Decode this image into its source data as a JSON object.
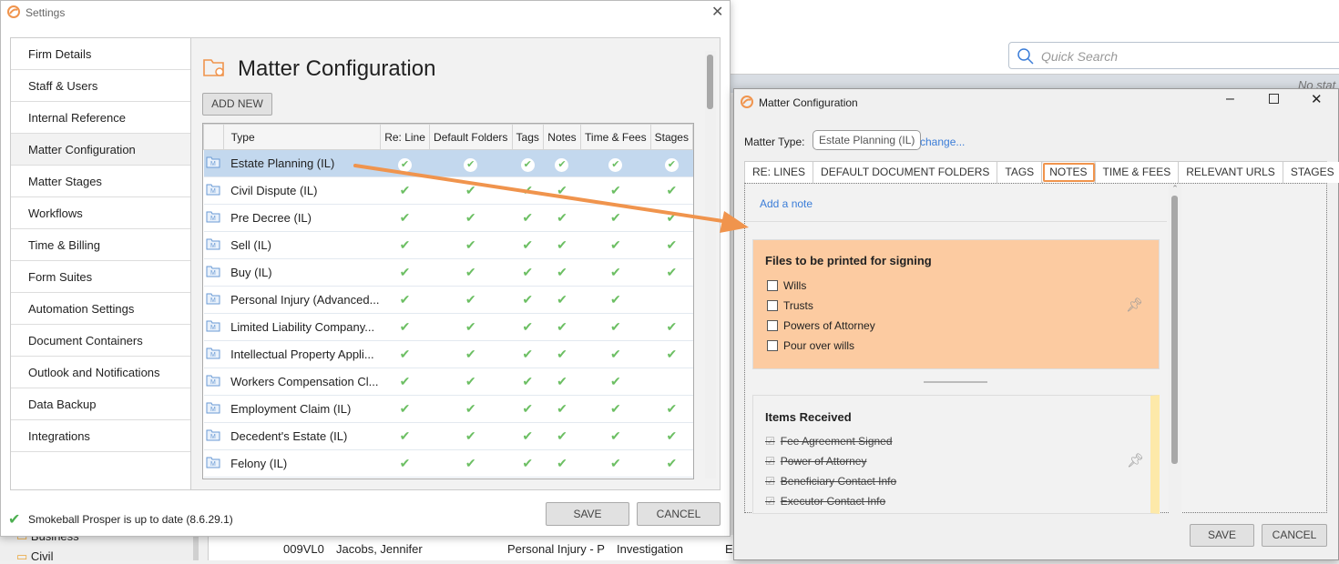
{
  "background": {
    "search_placeholder": "Quick Search",
    "no_status": "No stat",
    "tree": [
      "Business",
      "Civil"
    ],
    "row": {
      "id": "009VL0",
      "client": "Jacobs, Jennifer",
      "type": "Personal Injury - P",
      "stage": "Investigation",
      "more": "E"
    }
  },
  "settings": {
    "title": "Settings",
    "nav": [
      "Firm Details",
      "Staff & Users",
      "Internal Reference",
      "Matter Configuration",
      "Matter Stages",
      "Workflows",
      "Time & Billing",
      "Form Suites",
      "Automation Settings",
      "Document Containers",
      "Outlook and Notifications",
      "Data Backup",
      "Integrations"
    ],
    "selected_nav": 3,
    "page_title": "Matter Configuration",
    "add_new": "ADD NEW",
    "columns": [
      "Type",
      "Re: Line",
      "Default Folders",
      "Tags",
      "Notes",
      "Time & Fees",
      "Stages"
    ],
    "rows": [
      {
        "type": "Estate Planning (IL)",
        "checks": [
          true,
          true,
          true,
          true,
          true,
          true
        ],
        "selected": true
      },
      {
        "type": "Civil Dispute (IL)",
        "checks": [
          true,
          true,
          true,
          true,
          true,
          true
        ]
      },
      {
        "type": "Pre Decree (IL)",
        "checks": [
          true,
          true,
          true,
          true,
          true,
          true
        ]
      },
      {
        "type": "Sell (IL)",
        "checks": [
          true,
          true,
          true,
          true,
          true,
          true
        ]
      },
      {
        "type": "Buy (IL)",
        "checks": [
          true,
          true,
          true,
          true,
          true,
          true
        ]
      },
      {
        "type": "Personal Injury (Advanced...",
        "checks": [
          true,
          true,
          true,
          true,
          true,
          false
        ]
      },
      {
        "type": "Limited Liability Company...",
        "checks": [
          true,
          true,
          true,
          true,
          true,
          true
        ]
      },
      {
        "type": "Intellectual Property Appli...",
        "checks": [
          true,
          true,
          true,
          true,
          true,
          true
        ]
      },
      {
        "type": "Workers Compensation Cl...",
        "checks": [
          true,
          true,
          true,
          true,
          true,
          false
        ]
      },
      {
        "type": "Employment Claim (IL)",
        "checks": [
          true,
          true,
          true,
          true,
          true,
          true
        ]
      },
      {
        "type": "Decedent's Estate (IL)",
        "checks": [
          true,
          true,
          true,
          true,
          true,
          true
        ]
      },
      {
        "type": "Felony (IL)",
        "checks": [
          true,
          true,
          true,
          true,
          true,
          true
        ]
      }
    ],
    "status": "Smokeball Prosper is up to date (8.6.29.1)",
    "save": "SAVE",
    "cancel": "CANCEL"
  },
  "dialog": {
    "title": "Matter Configuration",
    "matter_type_label": "Matter Type:",
    "matter_type": "Estate Planning (IL)",
    "change": "change...",
    "tabs": [
      "RE: LINES",
      "DEFAULT DOCUMENT FOLDERS",
      "TAGS",
      "NOTES",
      "TIME & FEES",
      "RELEVANT URLS",
      "STAGES"
    ],
    "active_tab": 3,
    "add_note": "Add a note",
    "note1": {
      "title": "Files to be printed for signing",
      "items": [
        "Wills",
        "Trusts",
        "Powers of Attorney",
        "Pour over wills"
      ],
      "color": "#fccba1"
    },
    "note2": {
      "title": "Items Received",
      "items": [
        "Fee Agreement Signed",
        "Power of Attorney",
        "Beneficiary Contact Info",
        "Executor Contact Info"
      ],
      "color": "#f2f2f2"
    },
    "save": "SAVE",
    "cancel": "CANCEL"
  },
  "colors": {
    "accent": "#f0944d",
    "check": "#6cbf63",
    "selection": "#c3d8ee",
    "link": "#3b7dd8"
  }
}
